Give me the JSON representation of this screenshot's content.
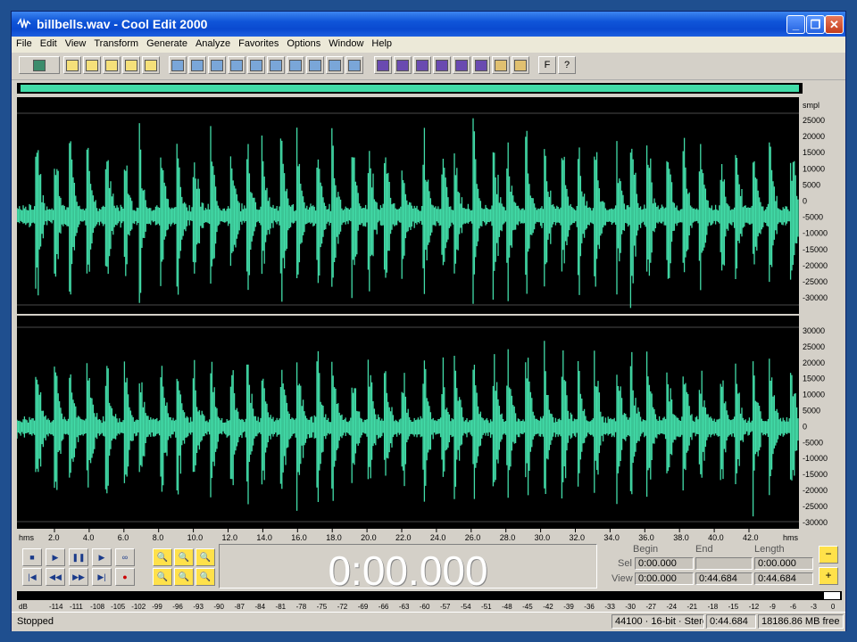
{
  "window": {
    "title": "billbells.wav - Cool Edit 2000",
    "minimize": "_",
    "maximize": "❐",
    "close": "✕"
  },
  "menu": [
    "File",
    "Edit",
    "View",
    "Transform",
    "Generate",
    "Analyze",
    "Favorites",
    "Options",
    "Window",
    "Help"
  ],
  "toolbar": {
    "buttons": [
      "multitrack-toggle-icon",
      "new-icon",
      "open-icon",
      "close-icon",
      "save-icon",
      "save-as-icon",
      "undo-icon",
      "repeat-icon",
      "cut-icon",
      "copy-icon",
      "paste-icon",
      "mix-paste-icon",
      "trim-icon",
      "delete-silence-icon",
      "amplify-icon",
      "noise-reduction-icon",
      "spectral-view-icon",
      "waveform-view-icon",
      "cue-list-icon",
      "play-list-icon",
      "info-icon",
      "properties-icon",
      "cd-icon",
      "favorites-icon",
      "script-icon",
      "help-icon"
    ],
    "help_label": "?",
    "font_label": "F"
  },
  "waveform": {
    "colors": {
      "background": "#000000",
      "wave": "#42dca8",
      "ruler_bg": "#d4d0c8",
      "gridline": "#4a4a4a"
    },
    "amplitude_unit": "smpl",
    "channel_top_ticks": [
      "25000",
      "20000",
      "15000",
      "10000",
      "5000",
      "0",
      "-5000",
      "-10000",
      "-15000",
      "-20000",
      "-25000",
      "-30000"
    ],
    "channel_bottom_ticks": [
      "30000",
      "25000",
      "20000",
      "15000",
      "10000",
      "5000",
      "0",
      "-5000",
      "-10000",
      "-15000",
      "-20000",
      "-25000",
      "-30000"
    ]
  },
  "time_ruler": {
    "unit_left": "hms",
    "unit_right": "hms",
    "ticks": [
      "2.0",
      "4.0",
      "6.0",
      "8.0",
      "10.0",
      "12.0",
      "14.0",
      "16.0",
      "18.0",
      "20.0",
      "22.0",
      "24.0",
      "26.0",
      "28.0",
      "30.0",
      "32.0",
      "34.0",
      "36.0",
      "38.0",
      "40.0",
      "42.0"
    ]
  },
  "transport": {
    "buttons": [
      "stop-icon",
      "play-icon",
      "pause-icon",
      "play-to-end-icon",
      "loop-icon",
      "go-to-start-icon",
      "rewind-icon",
      "fast-forward-icon",
      "go-to-end-icon",
      "record-icon"
    ]
  },
  "zoom": {
    "buttons": [
      "zoom-in-icon",
      "zoom-out-icon",
      "zoom-full-icon",
      "zoom-left-icon",
      "zoom-right-icon",
      "zoom-selection-icon"
    ]
  },
  "time_display": "0:00.000",
  "selection": {
    "headers": {
      "begin": "Begin",
      "end": "End",
      "length": "Length"
    },
    "sel": {
      "label": "Sel",
      "begin": "0:00.000",
      "end": "",
      "length": "0:00.000"
    },
    "view": {
      "label": "View",
      "begin": "0:00.000",
      "end": "0:44.684",
      "length": "0:44.684"
    }
  },
  "meter": {
    "unit": "dB",
    "ticks": [
      "-114",
      "-111",
      "-108",
      "-105",
      "-102",
      "-99",
      "-96",
      "-93",
      "-90",
      "-87",
      "-84",
      "-81",
      "-78",
      "-75",
      "-72",
      "-69",
      "-66",
      "-63",
      "-60",
      "-57",
      "-54",
      "-51",
      "-48",
      "-45",
      "-42",
      "-39",
      "-36",
      "-33",
      "-30",
      "-27",
      "-24",
      "-21",
      "-18",
      "-15",
      "-12",
      "-9",
      "-6",
      "-3",
      "0"
    ]
  },
  "status": {
    "state": "Stopped",
    "format": "44100 · 16-bit · Stereo",
    "length": "0:44.684",
    "free": "18186.86 MB free"
  }
}
